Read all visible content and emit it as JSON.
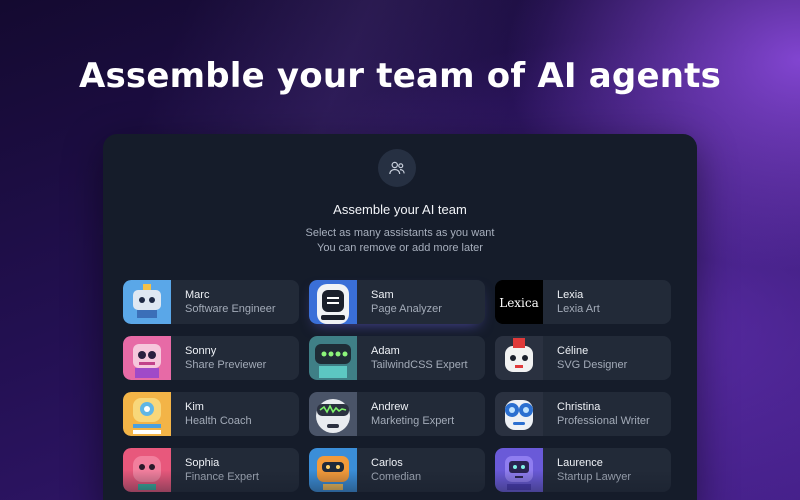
{
  "headline": "Assemble your team of AI agents",
  "panel": {
    "icon": "team-icon",
    "title": "Assemble your AI team",
    "subtitle_line1": "Select as many assistants as you want",
    "subtitle_line2": "You can remove or add more later"
  },
  "agents": [
    {
      "name": "Marc",
      "role": "Software Engineer",
      "avatar": "blue-robot-icon"
    },
    {
      "name": "Sam",
      "role": "Page Analyzer",
      "avatar": "white-robot-icon"
    },
    {
      "name": "Lexia",
      "role": "Lexia Art",
      "avatar": "lexica-logo"
    },
    {
      "name": "Sonny",
      "role": "Share Previewer",
      "avatar": "pink-robot-icon"
    },
    {
      "name": "Adam",
      "role": "TailwindCSS Expert",
      "avatar": "teal-robot-icon"
    },
    {
      "name": "Céline",
      "role": "SVG Designer",
      "avatar": "red-white-robot-icon"
    },
    {
      "name": "Kim",
      "role": "Health Coach",
      "avatar": "yellow-robot-icon"
    },
    {
      "name": "Andrew",
      "role": "Marketing Expert",
      "avatar": "green-visor-robot-icon"
    },
    {
      "name": "Christina",
      "role": "Professional Writer",
      "avatar": "goggles-robot-icon"
    },
    {
      "name": "Sophia",
      "role": "Finance Expert",
      "avatar": "rose-robot-icon"
    },
    {
      "name": "Carlos",
      "role": "Comedian",
      "avatar": "orange-robot-icon"
    },
    {
      "name": "Laurence",
      "role": "Startup Lawyer",
      "avatar": "purple-robot-icon"
    }
  ],
  "lexica_logo_text": "Lexica"
}
